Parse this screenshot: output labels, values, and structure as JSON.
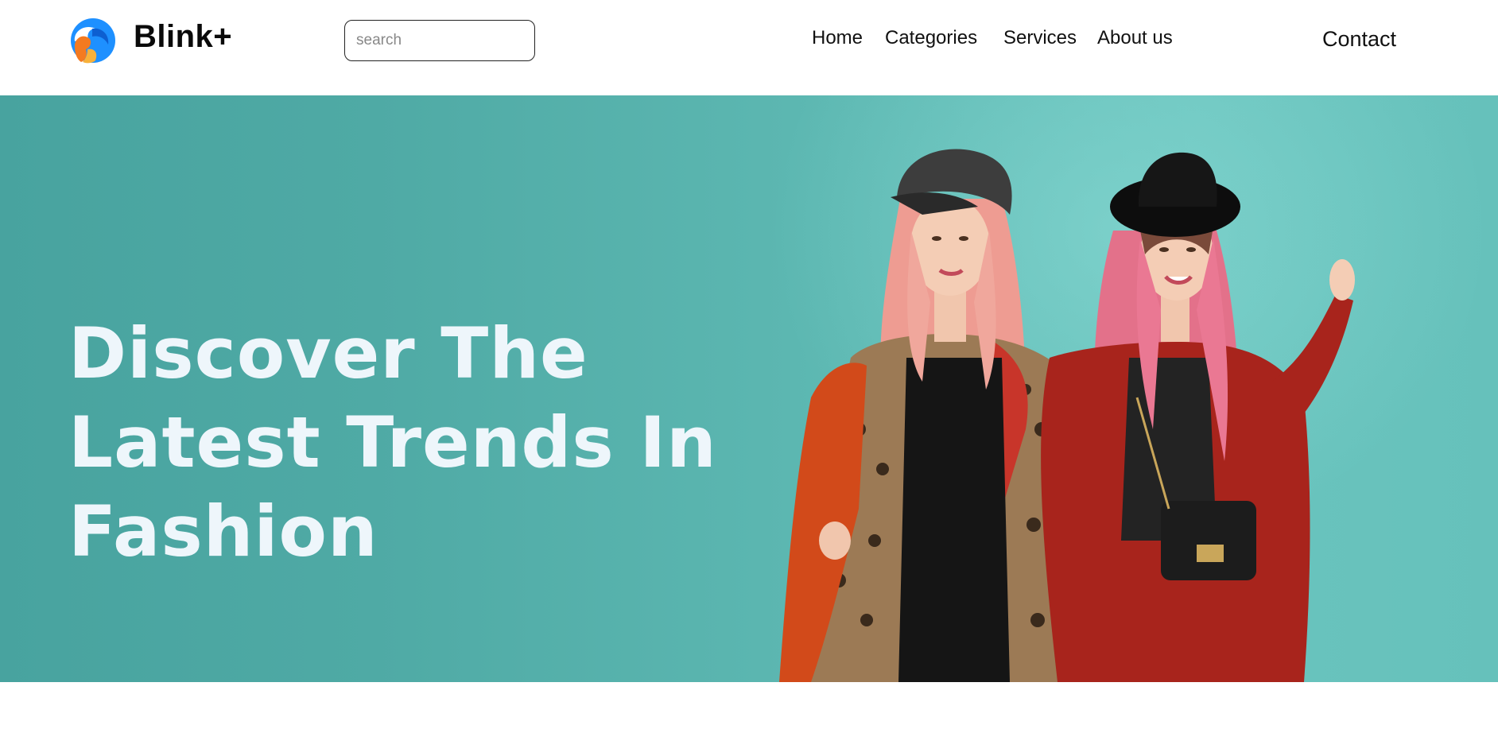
{
  "header": {
    "brand": "Blink+",
    "search": {
      "placeholder": "search",
      "value": ""
    },
    "nav": [
      {
        "label": "Home"
      },
      {
        "label": "Categories"
      },
      {
        "label": "Services"
      },
      {
        "label": "About us"
      }
    ],
    "contact_label": "Contact"
  },
  "hero": {
    "title_lines": [
      "Discover The",
      "Latest Trends In",
      "Fashion"
    ],
    "image_icon": "fashion-models-photo"
  },
  "colors": {
    "hero_bg": "#5db8b2",
    "hero_text": "#eef6fb",
    "logo_blue": "#1e90ff",
    "logo_orange": "#f47a20"
  }
}
